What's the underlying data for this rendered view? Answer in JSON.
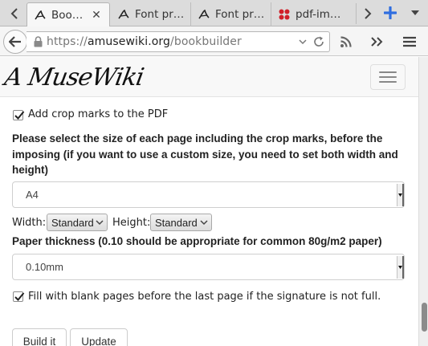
{
  "tabs": [
    {
      "title": "Boo…",
      "favicon": "amusewiki-icon",
      "active": true
    },
    {
      "title": "Font pr…",
      "favicon": "amusewiki-icon",
      "active": false
    },
    {
      "title": "Font pr…",
      "favicon": "amusewiki-icon",
      "active": false
    },
    {
      "title": "pdf-im…",
      "favicon": "red-dots-icon",
      "active": false
    }
  ],
  "navbar": {
    "url_scheme": "https://",
    "url_host": "amusewiki.org",
    "url_path": "/bookbuilder"
  },
  "site": {
    "logo_text": "A MuseWiki"
  },
  "form": {
    "crop_marks_label": "Add crop marks to the PDF",
    "crop_marks_checked": true,
    "page_size_heading": "Please select the size of each page including the crop marks, before the imposing (if you want to use a custom size, you need to set both width and height)",
    "page_size_value": "A4",
    "width_label": "Width:",
    "width_value": "Standard",
    "height_label": "Height:",
    "height_value": "Standard",
    "paper_thickness_heading": "Paper thickness (0.10 should be appropriate for common 80g/m2 paper)",
    "paper_thickness_value": "0.10mm",
    "blank_pages_label": "Fill with blank pages before the last page if the signature is not full.",
    "blank_pages_checked": true,
    "build_button": "Build it",
    "update_button": "Update"
  },
  "colors": {
    "firefox_plus": "#2f6ee0",
    "favicon_red": "#d0202a"
  }
}
